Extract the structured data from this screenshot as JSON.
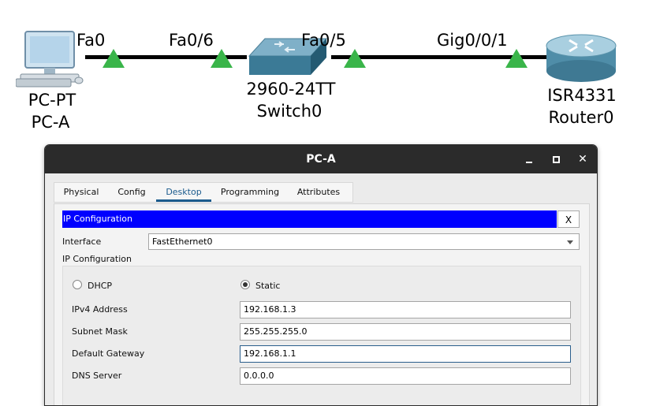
{
  "topology": {
    "pc": {
      "type_label": "PC-PT",
      "name": "PC-A",
      "port": "Fa0"
    },
    "switch": {
      "type_label": "2960-24TT",
      "name": "Switch0",
      "port_left": "Fa0/6",
      "port_right": "Fa0/5"
    },
    "router": {
      "type_label": "ISR4331",
      "name": "Router0",
      "port": "Gig0/0/1"
    },
    "link_indicator_color": "#3ab54a"
  },
  "window": {
    "title": "PC-A",
    "controls": {
      "minimize": "minimize-icon",
      "maximize": "maximize-icon",
      "close": "✕"
    }
  },
  "tabs": [
    {
      "label": "Physical"
    },
    {
      "label": "Config"
    },
    {
      "label": "Desktop",
      "active": true
    },
    {
      "label": "Programming"
    },
    {
      "label": "Attributes"
    }
  ],
  "ip_config": {
    "header": "IP Configuration",
    "close_label": "X",
    "interface_label": "Interface",
    "interface_value": "FastEthernet0",
    "section_label": "IP Configuration",
    "dhcp_label": "DHCP",
    "static_label": "Static",
    "mode_selected": "Static",
    "fields": {
      "ipv4_label": "IPv4 Address",
      "ipv4_value": "192.168.1.3",
      "subnet_label": "Subnet Mask",
      "subnet_value": "255.255.255.0",
      "gateway_label": "Default Gateway",
      "gateway_value": "192.168.1.1",
      "dns_label": "DNS Server",
      "dns_value": "0.0.0.0"
    }
  },
  "colors": {
    "titlebar": "#2b2b2b",
    "header_bar": "#0000ff",
    "active_tab": "#1b5b8d"
  }
}
